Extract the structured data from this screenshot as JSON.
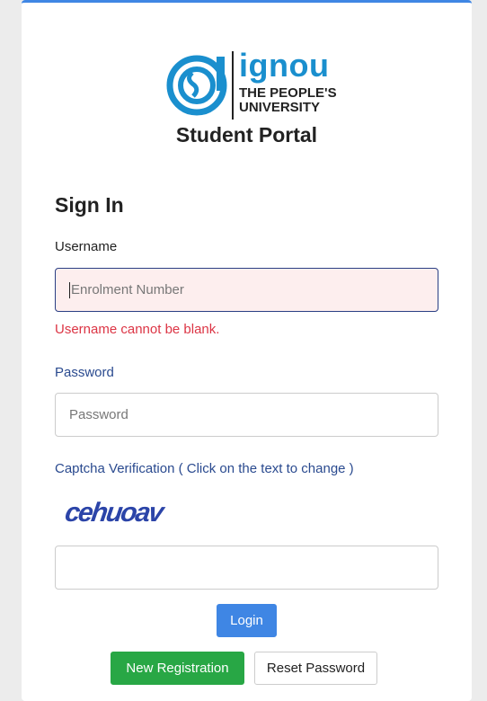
{
  "brand": {
    "name": "ignou",
    "tagline_line1": "THE PEOPLE'S",
    "tagline_line2": "UNIVERSITY",
    "portal_title": "Student Portal"
  },
  "form": {
    "heading": "Sign In",
    "username": {
      "label": "Username",
      "placeholder": "Enrolment Number",
      "value": "",
      "error": "Username cannot be blank."
    },
    "password": {
      "label": "Password",
      "placeholder": "Password",
      "value": ""
    },
    "captcha": {
      "label": "Captcha Verification ( Click on the text to change )",
      "image_text": "cehuoav",
      "value": ""
    }
  },
  "buttons": {
    "login": "Login",
    "new_registration": "New Registration",
    "reset_password": "Reset Password"
  },
  "colors": {
    "accent": "#3f86e4",
    "success": "#28a745",
    "error": "#dc3545",
    "logo_blue": "#1a8fce"
  }
}
